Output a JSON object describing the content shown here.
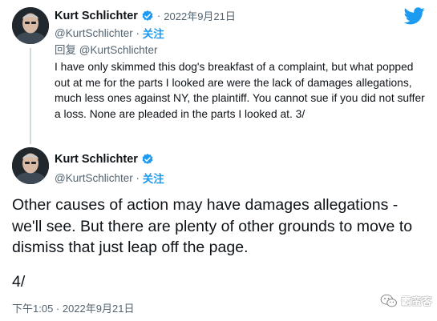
{
  "app": {
    "logo": "twitter-bird-icon",
    "accent": "#1d9bf0"
  },
  "tweet1": {
    "display_name": "Kurt Schlichter",
    "verified": "verified-badge-icon",
    "separator": "·",
    "date": "2022年9月21日",
    "handle": "@KurtSchlichter",
    "handle_separator": " · ",
    "follow_label": "关注",
    "reply_prefix": "回复",
    "reply_to": "@KurtSchlichter",
    "text": "I have only skimmed this dog's breakfast of a complaint, but what popped out at me for the parts I looked are were the lack of damages allegations, much less ones against NY, the plaintiff. You cannot sue if you did not suffer a loss. None are pleaded in the parts I looked at. 3/"
  },
  "tweet2": {
    "display_name": "Kurt Schlichter",
    "verified": "verified-badge-icon",
    "handle": "@KurtSchlichter",
    "handle_separator": " · ",
    "follow_label": "关注",
    "text": "Other causes of action may have damages allegations - we'll see. But there are plenty of other grounds to move to dismiss that just leap off the page.",
    "text_end": "4/",
    "timestamp": "下午1:05 · 2022年9月21日"
  },
  "watermark": {
    "icon": "wechat-icon",
    "text": "霸蛮客"
  }
}
